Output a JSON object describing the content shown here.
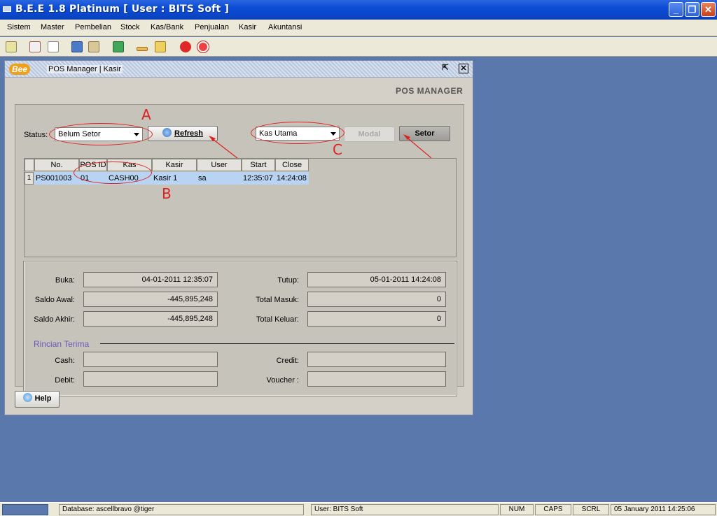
{
  "window": {
    "title": "B.E.E 1.8 Platinum [ User : BITS Soft ]"
  },
  "menu": [
    "Sistem",
    "Master",
    "Pembelian",
    "Stock",
    "Kas/Bank",
    "Penjualan",
    "Kasir",
    "Akuntansi"
  ],
  "toolbar_icons": [
    "note-icon",
    "edit-icon",
    "page-icon",
    "people-icon",
    "clipboard-icon",
    "chart-icon",
    "ruler-icon",
    "folder-icon",
    "stop-icon",
    "power-icon"
  ],
  "frame": {
    "logo": "Bee",
    "title": "POS Manager | Kasir",
    "header_label": "POS MANAGER"
  },
  "filters": {
    "status_label": "Status:",
    "status_value": "Belum Setor",
    "refresh_label": "Refresh",
    "kas_value": "Kas Utama",
    "modal_label": "Modal",
    "setor_label": "Setor"
  },
  "annotations": {
    "a": "A",
    "b": "B",
    "c": "C"
  },
  "table": {
    "columns": [
      "No.",
      "POS ID",
      "Kas",
      "Kasir",
      "User",
      "Start",
      "Close"
    ],
    "rows": [
      {
        "index": "1",
        "no": "PS001003",
        "pos_id": "01",
        "kas": "CASH00",
        "kasir": "Kasir 1",
        "user": "sa",
        "start": "12:35:07",
        "close": "14:24:08"
      }
    ]
  },
  "detail": {
    "buka_label": "Buka:",
    "buka_value": "04-01-2011 12:35:07",
    "tutup_label": "Tutup:",
    "tutup_value": "05-01-2011 14:24:08",
    "saldo_awal_label": "Saldo Awal:",
    "saldo_awal_value": "-445,895,248",
    "total_masuk_label": "Total Masuk:",
    "total_masuk_value": "0",
    "saldo_akhir_label": "Saldo Akhir:",
    "saldo_akhir_value": "-445,895,248",
    "total_keluar_label": "Total Keluar:",
    "total_keluar_value": "0",
    "rincian_title": "Rincian Terima",
    "cash_label": "Cash:",
    "cash_value": "",
    "credit_label": "Credit:",
    "credit_value": "",
    "debit_label": "Debit:",
    "debit_value": "",
    "voucher_label": "Voucher :",
    "voucher_value": ""
  },
  "help_label": "Help",
  "statusbar": {
    "database": "Database: ascellbravo @tiger",
    "user": "User: BITS Soft",
    "num": "NUM",
    "caps": "CAPS",
    "scrl": "SCRL",
    "datetime": "05 January 2011  14:25:06"
  },
  "colors": {
    "titlebar": "#0c4bd6",
    "desktop": "#5a78ac",
    "row_selected": "#b8d4f2",
    "annotation": "#e02020",
    "section_title": "#6a5ab8"
  }
}
